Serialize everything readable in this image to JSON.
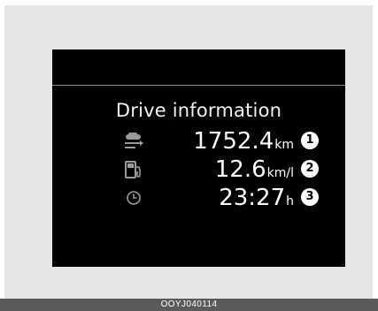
{
  "screen": {
    "title": "Drive information",
    "rows": [
      {
        "icon": "distance-icon",
        "value": "1752.4",
        "unit": "km",
        "marker": "1"
      },
      {
        "icon": "fuel-pump-icon",
        "value": "12.6",
        "unit": "km/l",
        "marker": "2"
      },
      {
        "icon": "clock-icon",
        "value": "23:27",
        "unit": "h",
        "marker": "3"
      }
    ]
  },
  "caption": "OOYJ040114"
}
